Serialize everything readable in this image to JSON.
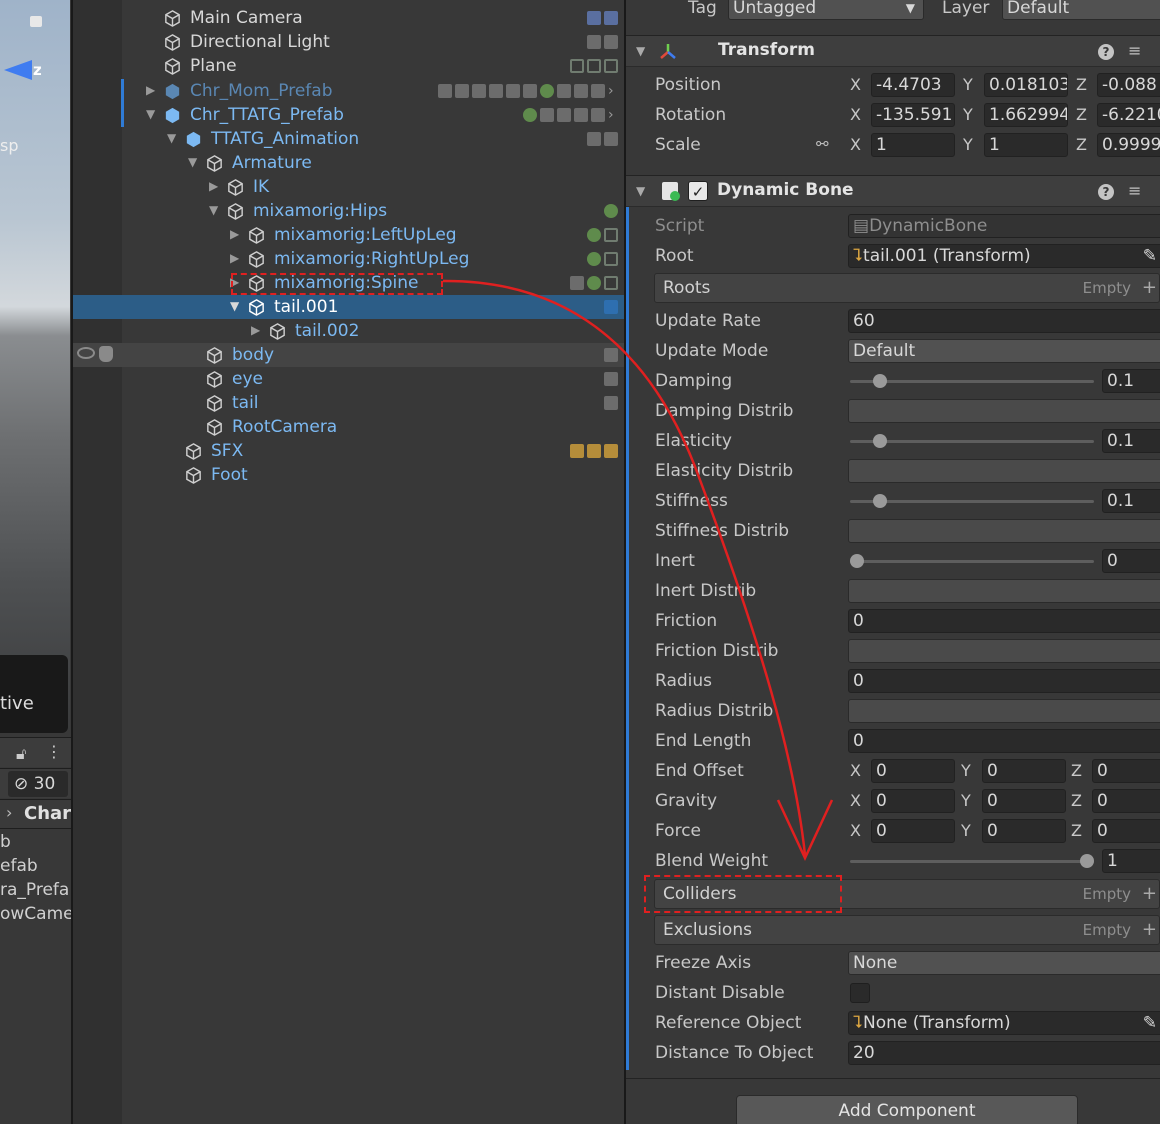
{
  "scene": {
    "axis_label": "z",
    "persp_label": "sp",
    "overlay_text": "tive",
    "hidden_count": "30",
    "breadcrumb": "Char",
    "list": [
      "b",
      "efab",
      "ra_Prefa",
      "owCame"
    ]
  },
  "hierarchy": {
    "items": [
      {
        "name": "Main Camera"
      },
      {
        "name": "Directional Light"
      },
      {
        "name": "Plane"
      },
      {
        "name": "Chr_Mom_Prefab"
      },
      {
        "name": "Chr_TTATG_Prefab"
      },
      {
        "name": "TTATG_Animation"
      },
      {
        "name": "Armature"
      },
      {
        "name": "IK"
      },
      {
        "name": "mixamorig:Hips"
      },
      {
        "name": "mixamorig:LeftUpLeg"
      },
      {
        "name": "mixamorig:RightUpLeg"
      },
      {
        "name": "mixamorig:Spine"
      },
      {
        "name": "tail.001"
      },
      {
        "name": "tail.002"
      },
      {
        "name": "body"
      },
      {
        "name": "eye"
      },
      {
        "name": "tail"
      },
      {
        "name": "RootCamera"
      },
      {
        "name": "SFX"
      },
      {
        "name": "Foot"
      }
    ],
    "selected": "tail.001"
  },
  "inspector": {
    "tag_label": "Tag",
    "tag_value": "Untagged",
    "layer_label": "Layer",
    "layer_value": "Default",
    "transform": {
      "title": "Transform",
      "position": {
        "label": "Position",
        "x": "-4.4703",
        "y": "0.018103",
        "z": "-0.088"
      },
      "rotation": {
        "label": "Rotation",
        "x": "-135.591",
        "y": "1.662994",
        "z": "-6.2210"
      },
      "scale": {
        "label": "Scale",
        "x": "1",
        "y": "1",
        "z": "0.9999"
      }
    },
    "axes": {
      "x": "X",
      "y": "Y",
      "z": "Z"
    },
    "dynamic_bone": {
      "title": "Dynamic Bone",
      "enabled": true,
      "script_label": "Script",
      "script_value": "DynamicBone",
      "root_label": "Root",
      "root_value": "tail.001 (Transform)",
      "roots_label": "Roots",
      "empty_text": "Empty",
      "update_rate_label": "Update Rate",
      "update_rate": "60",
      "update_mode_label": "Update Mode",
      "update_mode": "Default",
      "damping_label": "Damping",
      "damping": "0.1",
      "damping_distrib_label": "Damping Distrib",
      "elasticity_label": "Elasticity",
      "elasticity": "0.1",
      "elasticity_distrib_label": "Elasticity Distrib",
      "stiffness_label": "Stiffness",
      "stiffness": "0.1",
      "stiffness_distrib_label": "Stiffness Distrib",
      "inert_label": "Inert",
      "inert": "0",
      "inert_distrib_label": "Inert Distrib",
      "friction_label": "Friction",
      "friction": "0",
      "friction_distrib_label": "Friction Distrib",
      "radius_label": "Radius",
      "radius": "0",
      "radius_distrib_label": "Radius Distrib",
      "end_length_label": "End Length",
      "end_length": "0",
      "end_offset": {
        "label": "End Offset",
        "x": "0",
        "y": "0",
        "z": "0"
      },
      "gravity": {
        "label": "Gravity",
        "x": "0",
        "y": "0",
        "z": "0"
      },
      "force": {
        "label": "Force",
        "x": "0",
        "y": "0",
        "z": "0"
      },
      "blend_weight_label": "Blend Weight",
      "blend_weight": "1",
      "colliders_label": "Colliders",
      "exclusions_label": "Exclusions",
      "freeze_axis_label": "Freeze Axis",
      "freeze_axis": "None",
      "distant_disable_label": "Distant Disable",
      "reference_object_label": "Reference Object",
      "reference_object": "None (Transform)",
      "distance_to_object_label": "Distance To Object",
      "distance_to_object": "20"
    },
    "add_component": "Add Component"
  },
  "slider_levels": {
    "damping": 0.1,
    "elasticity": 0.1,
    "stiffness": 0.1,
    "inert": 0.0,
    "blend_weight": 1.0
  },
  "colors": {
    "selection": "#2c5d87",
    "prefab_text": "#7cb9f2",
    "annotation": "#e02020"
  }
}
